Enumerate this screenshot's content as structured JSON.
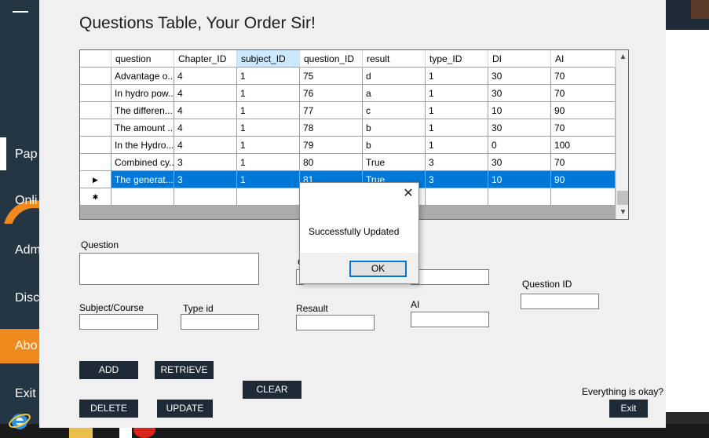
{
  "form": {
    "title": "Questions Table, Your Order Sir!"
  },
  "background": {
    "sidebar_items": [
      "Pap",
      "Onli",
      "Adm",
      "Disc",
      "Abo",
      "Exit"
    ]
  },
  "grid": {
    "columns": [
      "question",
      "Chapter_ID",
      "subject_ID",
      "question_ID",
      "result",
      "type_ID",
      "DI",
      "AI"
    ],
    "selected_column": "subject_ID",
    "rows": [
      [
        "Advantage o...",
        "4",
        "1",
        "75",
        "d",
        "1",
        "30",
        "70"
      ],
      [
        "In hydro pow...",
        "4",
        "1",
        "76",
        "a",
        "1",
        "30",
        "70"
      ],
      [
        "The differen...",
        "4",
        "1",
        "77",
        "c",
        "1",
        "10",
        "90"
      ],
      [
        "The amount ...",
        "4",
        "1",
        "78",
        "b",
        "1",
        "30",
        "70"
      ],
      [
        "In the Hydro...",
        "4",
        "1",
        "79",
        "b",
        "1",
        "0",
        "100"
      ],
      [
        "Combined cy...",
        "3",
        "1",
        "80",
        "True",
        "3",
        "30",
        "70"
      ],
      [
        "The generat...",
        "3",
        "1",
        "81",
        "True",
        "3",
        "10",
        "90"
      ]
    ],
    "selected_row_index": 6,
    "row_marker": "▶",
    "new_row_marker": "✱"
  },
  "fields": {
    "question_label": "Question",
    "subject_label": "Subject/Course",
    "type_label": "Type id",
    "result_label": "Resault",
    "ai_label": "AI",
    "question_id_label": "Question ID",
    "question_value": "",
    "subject_value": "",
    "type_value": "",
    "result_value": "",
    "ai_value": "",
    "question_id_value": "",
    "hidden_label_fragment": "C"
  },
  "buttons": {
    "add": "ADD",
    "retrieve": "RETRIEVE",
    "clear": "CLEAR",
    "delete": "DELETE",
    "update": "UPDATE",
    "exit": "Exit"
  },
  "prompt": "Everything is okay?",
  "dialog": {
    "message": "Successfully Updated",
    "ok": "OK",
    "close": "✕"
  },
  "colors": {
    "accent": "#f08a1c",
    "dark": "#1e2a35",
    "selection": "#0078d7",
    "header_selected": "#cce8ff"
  }
}
